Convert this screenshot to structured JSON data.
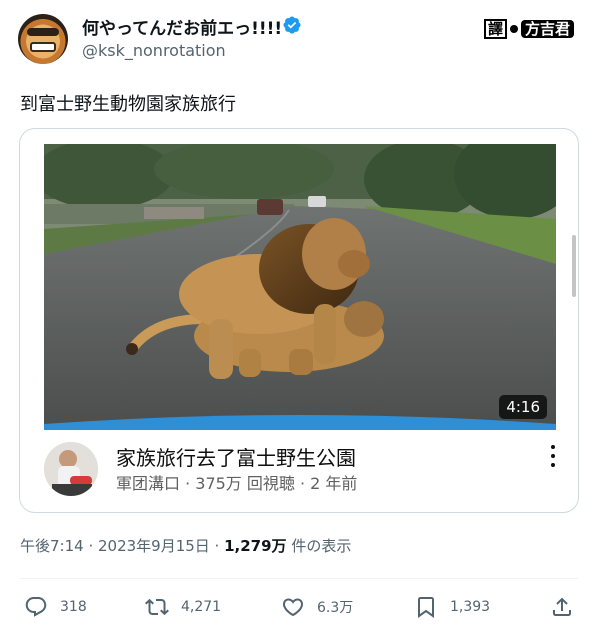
{
  "author": {
    "display_name": "何やってんだお前エっ!!!!",
    "handle": "@ksk_nonrotation",
    "avatar_icon": "angry-face-avatar",
    "verified_icon": "verified-badge-icon",
    "verified_color": "#1d9bf0"
  },
  "watermark": {
    "part1": "譯",
    "part2": "方吉君"
  },
  "tweet": {
    "text": "到富士野生動物園家族旅行"
  },
  "video_card": {
    "duration": "4:16",
    "title": "家族旅行去了富士野生公園",
    "meta": "軍团溝口 · 375万 回視聴 · 2 年前",
    "menu_icon": "more-vertical-icon"
  },
  "post_meta": {
    "time_date": "午後7:14 · 2023年9月15日 · ",
    "views_count": "1,279万",
    "views_label": " 件の表示"
  },
  "actions": {
    "replies": "318",
    "reposts": "4,271",
    "likes": "6.3万",
    "bookmarks": "1,393"
  },
  "colors": {
    "text_primary": "#0f1419",
    "text_secondary": "#536471",
    "border": "#cfd9de"
  }
}
